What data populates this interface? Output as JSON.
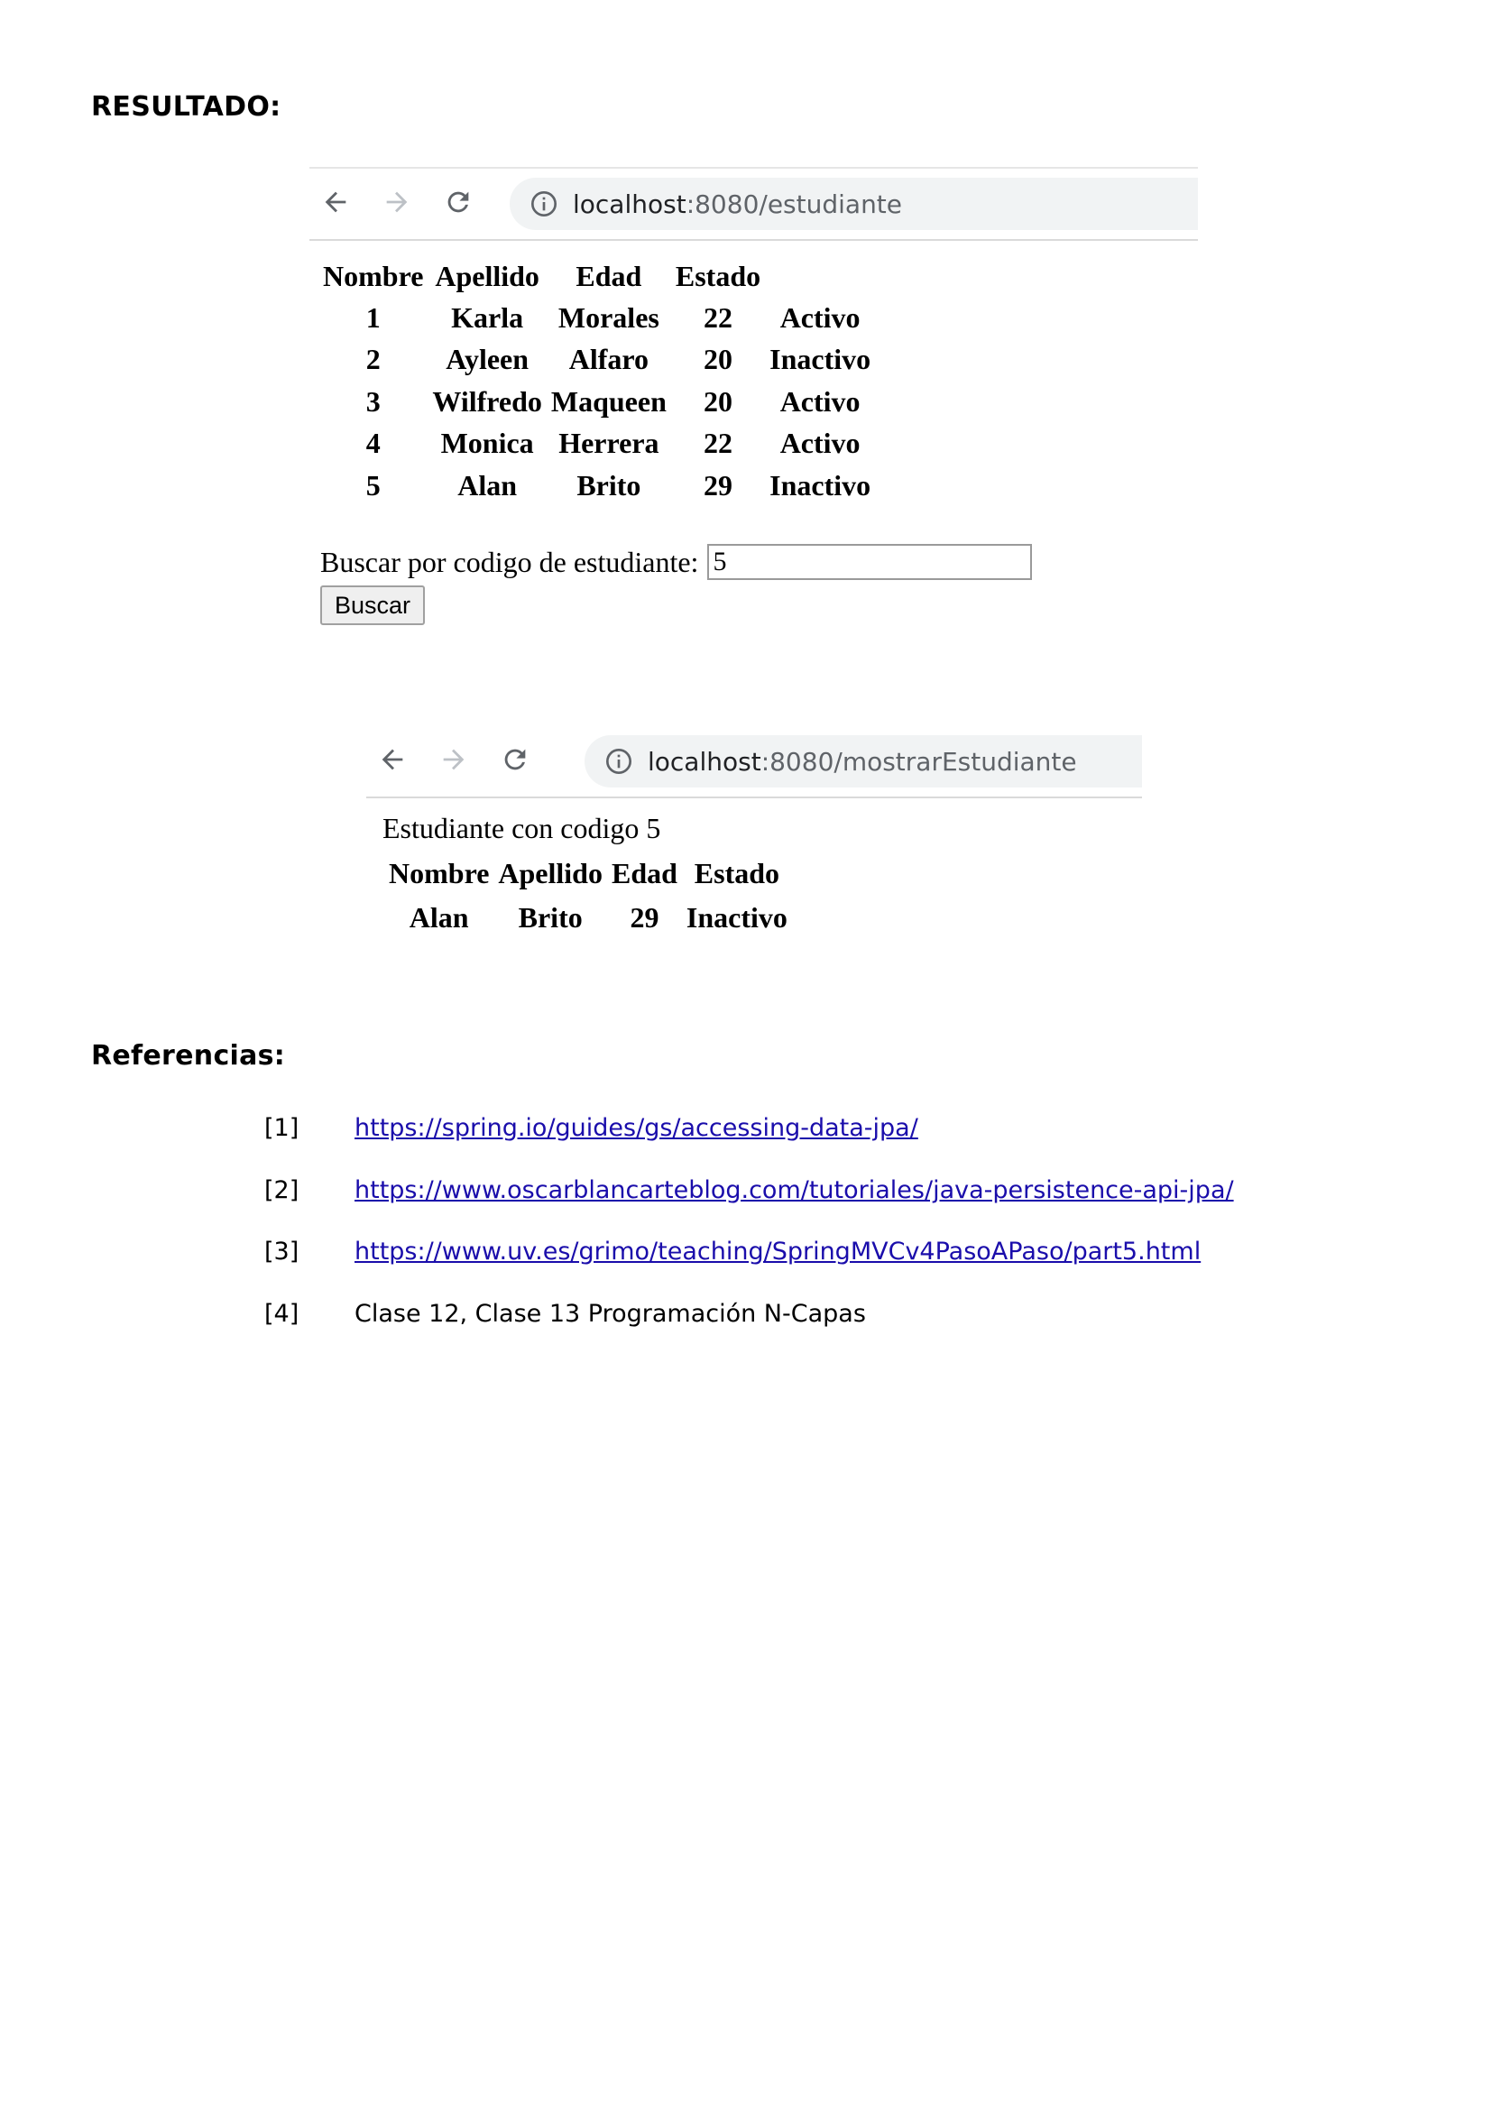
{
  "headings": {
    "resultado": "RESULTADO:",
    "referencias": "Referencias:"
  },
  "screenshot1": {
    "url": {
      "host": "localhost",
      "rest": ":8080/estudiante"
    },
    "table": {
      "headers": [
        "Nombre",
        "Apellido",
        "Edad",
        "Estado"
      ],
      "rows": [
        [
          "1",
          "Karla",
          "Morales",
          "22",
          "Activo"
        ],
        [
          "2",
          "Ayleen",
          "Alfaro",
          "20",
          "Inactivo"
        ],
        [
          "3",
          "Wilfredo",
          "Maqueen",
          "20",
          "Activo"
        ],
        [
          "4",
          "Monica",
          "Herrera",
          "22",
          "Activo"
        ],
        [
          "5",
          "Alan",
          "Brito",
          "29",
          "Inactivo"
        ]
      ]
    },
    "search": {
      "label": "Buscar por codigo de estudiante:",
      "value": "5",
      "button": "Buscar"
    }
  },
  "screenshot2": {
    "url": {
      "host": "localhost",
      "rest": ":8080/mostrarEstudiante"
    },
    "caption": "Estudiante con codigo 5",
    "table": {
      "headers": [
        "Nombre",
        "Apellido",
        "Edad",
        "Estado"
      ],
      "row": [
        "Alan",
        "Brito",
        "29",
        "Inactivo"
      ]
    }
  },
  "references": [
    {
      "num": "[1]",
      "text": "https://spring.io/guides/gs/accessing-data-jpa/",
      "is_link": true
    },
    {
      "num": "[2]",
      "text": "https://www.oscarblancarteblog.com/tutoriales/java-persistence-api-jpa/",
      "is_link": true
    },
    {
      "num": "[3]",
      "text": "https://www.uv.es/grimo/teaching/SpringMVCv4PasoAPaso/part5.html",
      "is_link": true
    },
    {
      "num": "[4]",
      "text": "Clase 12, Clase 13 Programación N-Capas",
      "is_link": false
    }
  ],
  "icons": {
    "back": "back-arrow-icon",
    "forward": "forward-arrow-icon",
    "reload": "reload-icon",
    "info": "info-icon"
  }
}
